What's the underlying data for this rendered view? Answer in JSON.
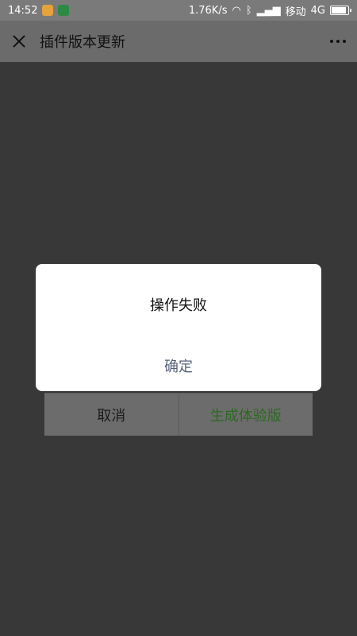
{
  "status_bar": {
    "time": "14:52",
    "network_speed": "1.76K/s",
    "carrier": "移动",
    "network_type": "4G",
    "battery_level": 0.9
  },
  "nav": {
    "title": "插件版本更新"
  },
  "actions": {
    "cancel_label": "取消",
    "primary_label": "生成体验版",
    "primary_color": "#2c6a21"
  },
  "dialog": {
    "message": "操作失败",
    "confirm_label": "确定"
  }
}
